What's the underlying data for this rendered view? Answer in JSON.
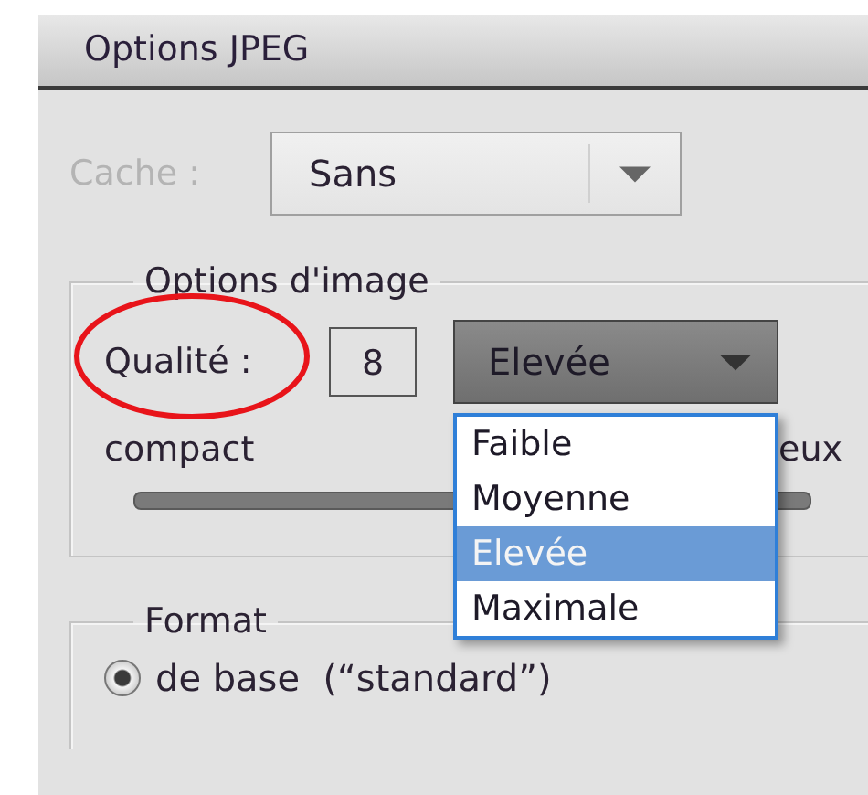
{
  "window": {
    "title": "Options JPEG"
  },
  "cache": {
    "label": "Cache :",
    "value": "Sans",
    "disabled": true
  },
  "image_options": {
    "title": "Options d'image",
    "quality_label": "Qualité :",
    "quality_value": "8",
    "quality_preset": "Elevée",
    "slider_left_label": "compact",
    "slider_right_label": "eux"
  },
  "quality_menu": {
    "expanded": true,
    "items": [
      {
        "label": "Faible",
        "selected": false
      },
      {
        "label": "Moyenne",
        "selected": false
      },
      {
        "label": "Elevée",
        "selected": true
      },
      {
        "label": "Maximale",
        "selected": false
      }
    ]
  },
  "format": {
    "title": "Format",
    "options": [
      {
        "label": "de base  (“standard”)",
        "selected": true
      }
    ]
  }
}
